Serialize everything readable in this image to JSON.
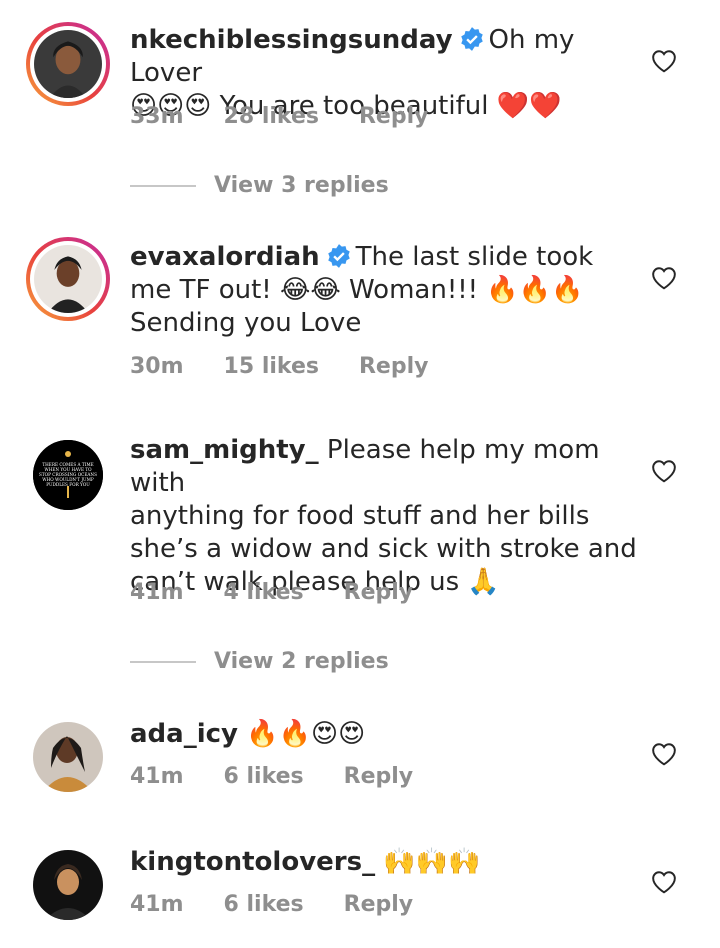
{
  "comments": [
    {
      "username": "nkechiblessingsunday",
      "verified": true,
      "text": "Oh my Lover",
      "emojis1": "",
      "line2_emojis": "😍😍😍",
      "line2_text": " You are too beautiful ",
      "line2_end": "❤️❤️",
      "time": "33m",
      "likes": "28 likes",
      "reply": "Reply",
      "view_replies": "View 3 replies"
    },
    {
      "username": "evaxalordiah",
      "verified": true,
      "text": "The last slide took",
      "line2_text": "me TF out! ",
      "line2_emojis": "😂😂",
      "line2_text_b": " Woman!!! ",
      "line2_end": "🔥🔥🔥",
      "line3": "Sending you Love",
      "time": "30m",
      "likes": "15 likes",
      "reply": "Reply"
    },
    {
      "username": "sam_mighty_",
      "text": " Please help my mom with",
      "line2": "anything for food stuff and her bills",
      "line3": "she’s a widow and sick with stroke and",
      "line4": "can’t walk please help us ",
      "line4_emoji": "🙏",
      "avatar_text": "THERE COMES A TIME WHEN YOU HAVE TO STOP CROSSING OCEANS FOR PEOPLE WHO WOULDN'T JUMP PUDDLES FOR YOU",
      "time": "41m",
      "likes": "4 likes",
      "reply": "Reply",
      "view_replies": "View 2 replies"
    },
    {
      "username": "ada_icy",
      "emojis": "🔥🔥😍😍",
      "time": "41m",
      "likes": "6 likes",
      "reply": "Reply"
    },
    {
      "username": "kingtontolovers_",
      "emojis": "🙌🙌🙌",
      "time": "41m",
      "likes": "6 likes",
      "reply": "Reply"
    }
  ],
  "colors": {
    "text": "#262626",
    "secondary": "#8e8e8e",
    "verified": "#3897f0"
  },
  "icons": {
    "like": "heart-outline-icon",
    "verified": "verified-badge-icon"
  }
}
